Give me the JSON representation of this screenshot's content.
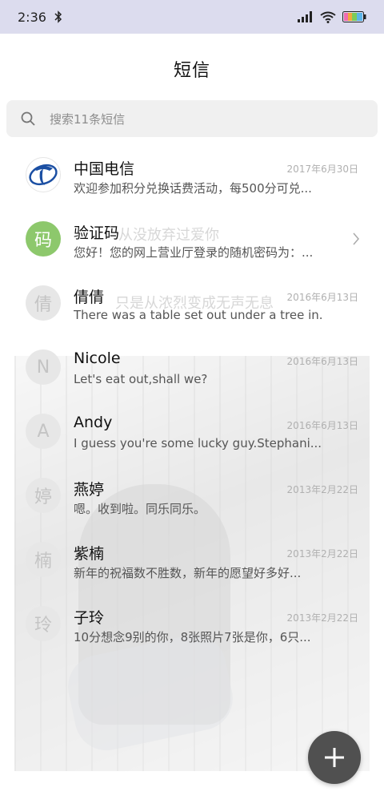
{
  "status_bar": {
    "time": "2:36"
  },
  "page": {
    "title": "短信"
  },
  "search": {
    "placeholder": "搜索11条短信"
  },
  "watermarks": [
    "从没放弃过爱你",
    "只是从浓烈变成无声无息"
  ],
  "conversations": [
    {
      "name": "中国电信",
      "date": "2017年6月30日",
      "preview": "欢迎参加积分兑换话费活动，每500分可兑...",
      "avatar_type": "logo",
      "avatar_text": ""
    },
    {
      "name": "验证码",
      "date": "",
      "preview": "您好！您的网上营业厅登录的随机密码为：...",
      "avatar_type": "green",
      "avatar_text": "码"
    },
    {
      "name": "倩倩",
      "date": "2016年6月13日",
      "preview": "There was a table set out under a tree in...",
      "avatar_type": "gray",
      "avatar_text": "倩"
    },
    {
      "name": "Nicole",
      "date": "2016年6月13日",
      "preview": "Let's eat out,shall we?",
      "avatar_type": "gray",
      "avatar_text": "N"
    },
    {
      "name": "Andy",
      "date": "2016年6月13日",
      "preview": "I guess you're some lucky guy.Stephani...",
      "avatar_type": "gray",
      "avatar_text": "A"
    },
    {
      "name": "燕婷",
      "date": "2013年2月22日",
      "preview": "嗯。收到啦。同乐同乐。",
      "avatar_type": "gray",
      "avatar_text": "婷"
    },
    {
      "name": "紫楠",
      "date": "2013年2月22日",
      "preview": "新年的祝福数不胜数，新年的愿望好多好...",
      "avatar_type": "gray",
      "avatar_text": "楠"
    },
    {
      "name": "子玲",
      "date": "2013年2月22日",
      "preview": "10分想念9别的你，8张照片7张是你，6只...",
      "avatar_type": "gray",
      "avatar_text": "玲"
    }
  ],
  "colors": {
    "status_bar_bg": "#dcdcee",
    "avatar_green": "#8dc86c",
    "fab_bg": "#505050"
  },
  "icons": {
    "status": [
      "bluetooth-icon",
      "signal-icon",
      "wifi-icon",
      "battery-icon"
    ],
    "search": "search-icon",
    "fab": "plus-icon",
    "chevron": "chevron-right-icon"
  }
}
